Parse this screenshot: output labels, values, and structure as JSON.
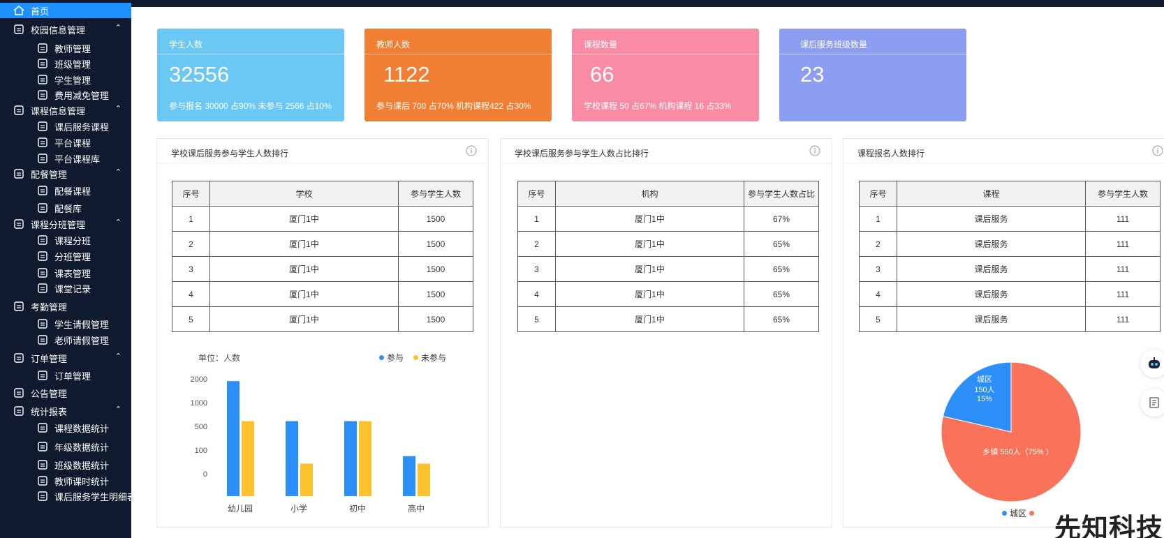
{
  "sidebar": {
    "items": [
      {
        "label": "首页",
        "icon": "home-icon",
        "active": true
      },
      {
        "label": "校园信息管理",
        "icon": "school-icon",
        "expanded": true
      },
      {
        "label": "教师管理",
        "icon": "teacher-icon"
      },
      {
        "label": "班级管理",
        "icon": "class-icon"
      },
      {
        "label": "学生管理",
        "icon": "student-icon"
      },
      {
        "label": "费用减免管理",
        "icon": "fee-icon"
      },
      {
        "label": "课程信息管理",
        "icon": "book-icon",
        "expanded": true
      },
      {
        "label": "课后服务课程",
        "icon": "service-icon"
      },
      {
        "label": "平台课程",
        "icon": "platform-icon"
      },
      {
        "label": "平台课程库",
        "icon": "layers-icon"
      },
      {
        "label": "配餐管理",
        "icon": "meal-icon",
        "expanded": true
      },
      {
        "label": "配餐课程",
        "icon": "meal-course-icon"
      },
      {
        "label": "配餐库",
        "icon": "grid-icon"
      },
      {
        "label": "课程分班管理",
        "icon": "split-icon",
        "expanded": true
      },
      {
        "label": "课程分班",
        "icon": "split-class-icon"
      },
      {
        "label": "分班管理",
        "icon": "grid-icon"
      },
      {
        "label": "课表管理",
        "icon": "calendar-icon"
      },
      {
        "label": "课堂记录",
        "icon": "record-icon"
      },
      {
        "label": "考勤管理",
        "icon": "check-icon"
      },
      {
        "label": "学生请假管理",
        "icon": "leave-icon"
      },
      {
        "label": "老师请假管理",
        "icon": "teacher-leave-icon"
      },
      {
        "label": "订单管理",
        "icon": "order-icon",
        "expanded": true
      },
      {
        "label": "订单管理",
        "icon": "order-icon"
      },
      {
        "label": "公告管理",
        "icon": "notice-icon"
      },
      {
        "label": "统计报表",
        "icon": "report-icon",
        "expanded": true
      },
      {
        "label": "课程数据统计",
        "icon": "chart-icon"
      },
      {
        "label": "年级数据统计",
        "icon": "bar-icon"
      },
      {
        "label": "班级数据统计",
        "icon": "table-icon"
      },
      {
        "label": "教师课时统计",
        "icon": "pie-icon"
      },
      {
        "label": "课后服务学生明细表",
        "icon": "list-icon"
      }
    ]
  },
  "cards": [
    {
      "title": "学生人数",
      "value": "32556",
      "sub": "参与报名 30000  占90%    未参与 2566  占10%",
      "color": "#6bc8f5"
    },
    {
      "title": "教师人数",
      "value": "1122",
      "sub": "参与课后 700 占70%    机构课程422 占30%",
      "color": "#f07e33"
    },
    {
      "title": "课程数量",
      "value": "66",
      "sub": "学校课程 50 占67%    机构课程 16 占33%",
      "color": "#f98ba4"
    },
    {
      "title": "课后服务班级数量",
      "value": "23",
      "sub": "",
      "color": "#8b9ef0"
    }
  ],
  "panels": {
    "school": {
      "title": "学校课后服务参与学生人数排行",
      "headers": [
        "序号",
        "学校",
        "参与学生人数"
      ],
      "rows": [
        [
          "1",
          "厦门1中",
          "1500"
        ],
        [
          "2",
          "厦门1中",
          "1500"
        ],
        [
          "3",
          "厦门1中",
          "1500"
        ],
        [
          "4",
          "厦门1中",
          "1500"
        ],
        [
          "5",
          "厦门1中",
          "1500"
        ]
      ]
    },
    "org": {
      "title": "学校课后服务参与学生人数占比排行",
      "headers": [
        "序号",
        "机构",
        "参与学生人数占比"
      ],
      "rows": [
        [
          "1",
          "厦门1中",
          "67%"
        ],
        [
          "2",
          "厦门1中",
          "65%"
        ],
        [
          "3",
          "厦门1中",
          "65%"
        ],
        [
          "4",
          "厦门1中",
          "65%"
        ],
        [
          "5",
          "厦门1中",
          "65%"
        ]
      ]
    },
    "course": {
      "title": "课程报名人数排行",
      "headers": [
        "序号",
        "课程",
        "参与学生人数"
      ],
      "rows": [
        [
          "1",
          "课后服务",
          "111"
        ],
        [
          "2",
          "课后服务",
          "111"
        ],
        [
          "3",
          "课后服务",
          "111"
        ],
        [
          "4",
          "课后服务",
          "111"
        ],
        [
          "5",
          "课后服务",
          "111"
        ]
      ]
    }
  },
  "chart_data": [
    {
      "type": "bar",
      "unit_label": "单位：人数",
      "categories": [
        "幼儿园",
        "小学",
        "初中",
        "高中"
      ],
      "y_tick_labels": [
        "2000",
        "1000",
        "500",
        "100",
        "0"
      ],
      "series": [
        {
          "name": "参与",
          "values": [
            2300,
            1500,
            1500,
            800
          ],
          "color": "#2b8ff7"
        },
        {
          "name": "未参与",
          "values": [
            1500,
            650,
            1500,
            650
          ],
          "color": "#fcc22d"
        }
      ]
    },
    {
      "type": "pie",
      "slices": [
        {
          "name": "城区",
          "value": 150,
          "unit": "人",
          "percent": "15%",
          "color": "#2b8ff7"
        },
        {
          "name": "乡镇",
          "value": 550,
          "unit": "人",
          "percent": "75%",
          "color": "#f8735a"
        }
      ],
      "label_top": [
        "城区",
        "150人",
        "15%"
      ],
      "label_main": "乡镇 550人（75% ）",
      "legend": [
        "城区"
      ]
    }
  ],
  "watermark": "先知科技"
}
